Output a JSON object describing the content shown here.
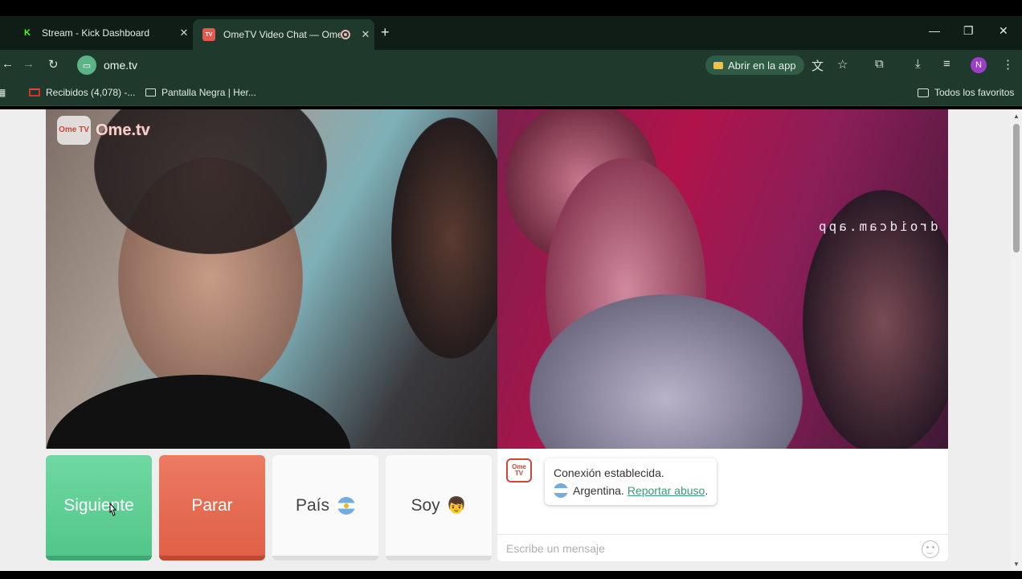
{
  "browser": {
    "tabs": [
      {
        "title": "Stream - Kick Dashboard",
        "favicon": "K",
        "favicon_color": "#53fc18",
        "active": false
      },
      {
        "title": "OmeTV Video Chat — Ome",
        "favicon": "TV",
        "favicon_color": "#e05a4e",
        "active": true,
        "recording": true
      }
    ],
    "url": "ome.tv",
    "open_app_label": "Abrir en la app",
    "profile_initial": "N",
    "profile_color": "#9b3fc9",
    "bookmarks": [
      {
        "label": "Recibidos (4,078) -...",
        "icon": "gmail-icon"
      },
      {
        "label": "Pantalla Negra | Her...",
        "icon": "screen-icon"
      }
    ],
    "all_bookmarks_label": "Todos los favoritos"
  },
  "page": {
    "logo_badge": "Ome TV",
    "logo_text": "Ome.tv",
    "remote_watermark": "droidcam.app",
    "buttons": {
      "next": "Siguiente",
      "stop": "Parar",
      "country": "País",
      "gender": "Soy"
    },
    "chat": {
      "status_line1": "Conexión establecida.",
      "country": "Argentina.",
      "report_link": "Reportar abuso",
      "report_suffix": ".",
      "input_placeholder": "Escribe un mensaje"
    },
    "colors": {
      "next_button": "#5ccf93",
      "stop_button": "#e66a51",
      "link": "#3a9a74"
    }
  }
}
